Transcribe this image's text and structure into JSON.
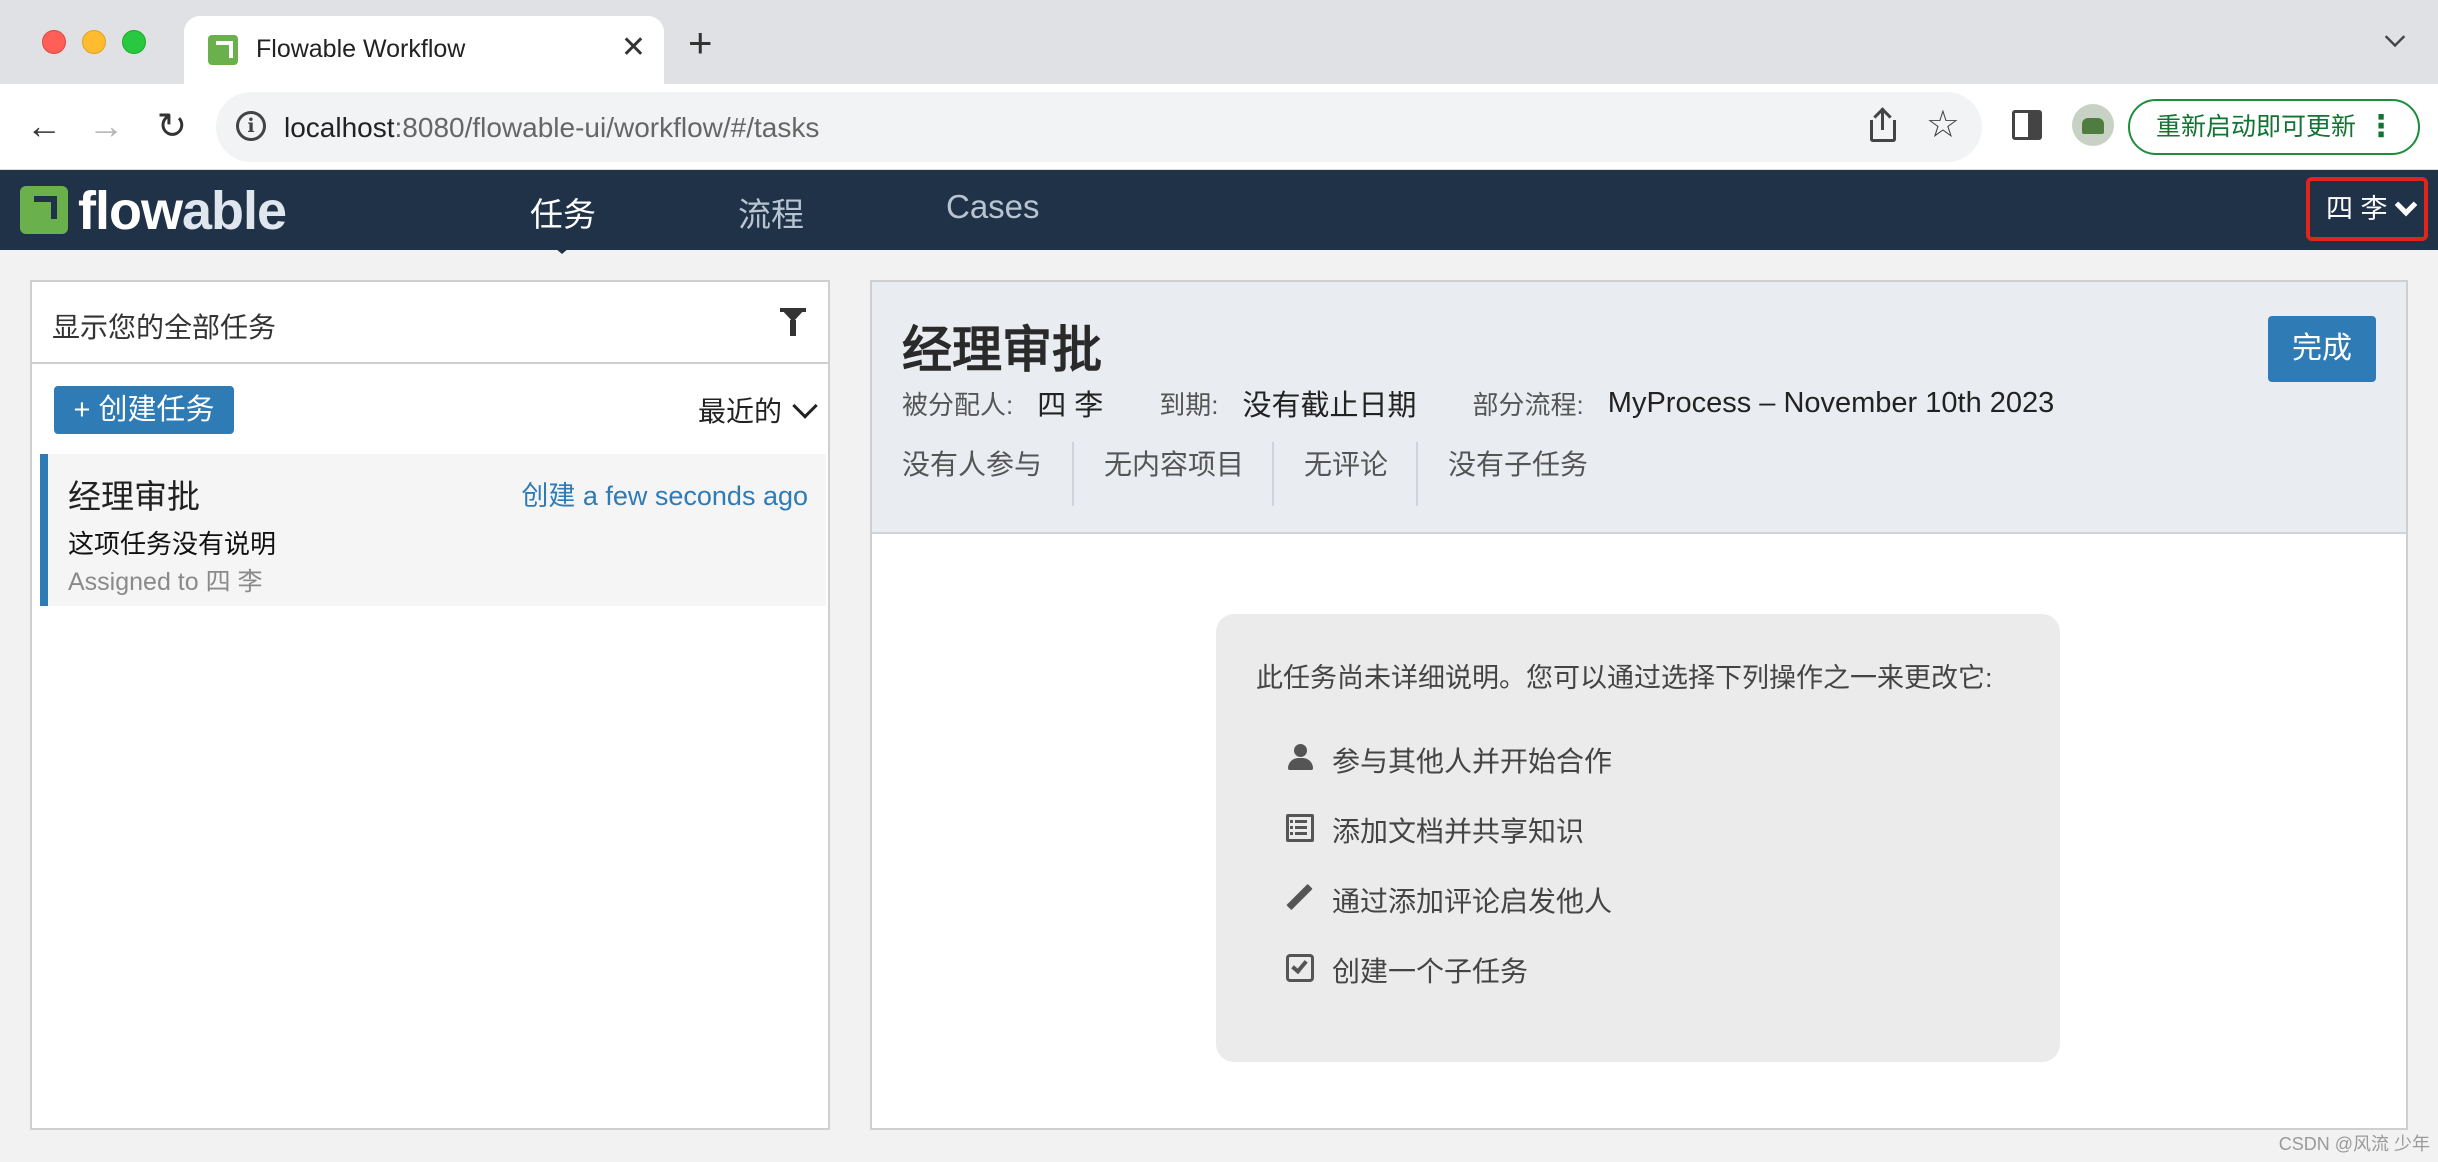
{
  "browser": {
    "tab_title": "Flowable Workflow",
    "tab_close": "✕",
    "new_tab": "+",
    "url_host": "localhost",
    "url_rest": ":8080/flowable-ui/workflow/#/tasks",
    "update_button": "重新启动即可更新",
    "update_menu": "⋮",
    "back": "←",
    "forward": "→",
    "reload": "↻",
    "star": "☆"
  },
  "navbar": {
    "logo_flow": "flow",
    "logo_able": "able",
    "links": [
      "任务",
      "流程",
      "Cases"
    ],
    "user": "四 李"
  },
  "task_list": {
    "filter_text": "显示您的全部任务",
    "create_button": "+ 创建任务",
    "sort_label": "最近的",
    "tasks": [
      {
        "name": "经理审批",
        "created": "创建 a few seconds ago",
        "description": "这项任务没有说明",
        "assigned": "Assigned to 四 李"
      }
    ]
  },
  "task_detail": {
    "title": "经理审批",
    "complete_button": "完成",
    "assignee_label": "被分配人:",
    "assignee_value": "四 李",
    "due_label": "到期:",
    "due_value": "没有截止日期",
    "process_label": "部分流程:",
    "process_value": "MyProcess – November 10th 2023",
    "tabs": [
      "没有人参与",
      "无内容项目",
      "无评论",
      "没有子任务"
    ]
  },
  "help": {
    "intro": "此任务尚未详细说明。您可以通过选择下列操作之一来更改它:",
    "actions": [
      {
        "icon": "user-icon",
        "label": "参与其他人并开始合作"
      },
      {
        "icon": "document-icon",
        "label": "添加文档并共享知识"
      },
      {
        "icon": "pencil-icon",
        "label": "通过添加评论启发他人"
      },
      {
        "icon": "checkbox-icon",
        "label": "创建一个子任务"
      }
    ]
  },
  "colors": {
    "navbar_bg": "#1f3247",
    "accent_blue": "#2e7bb6",
    "brand_green": "#6ab04c",
    "highlight_red": "#e1251b"
  },
  "watermark": "CSDN @风流 少年"
}
